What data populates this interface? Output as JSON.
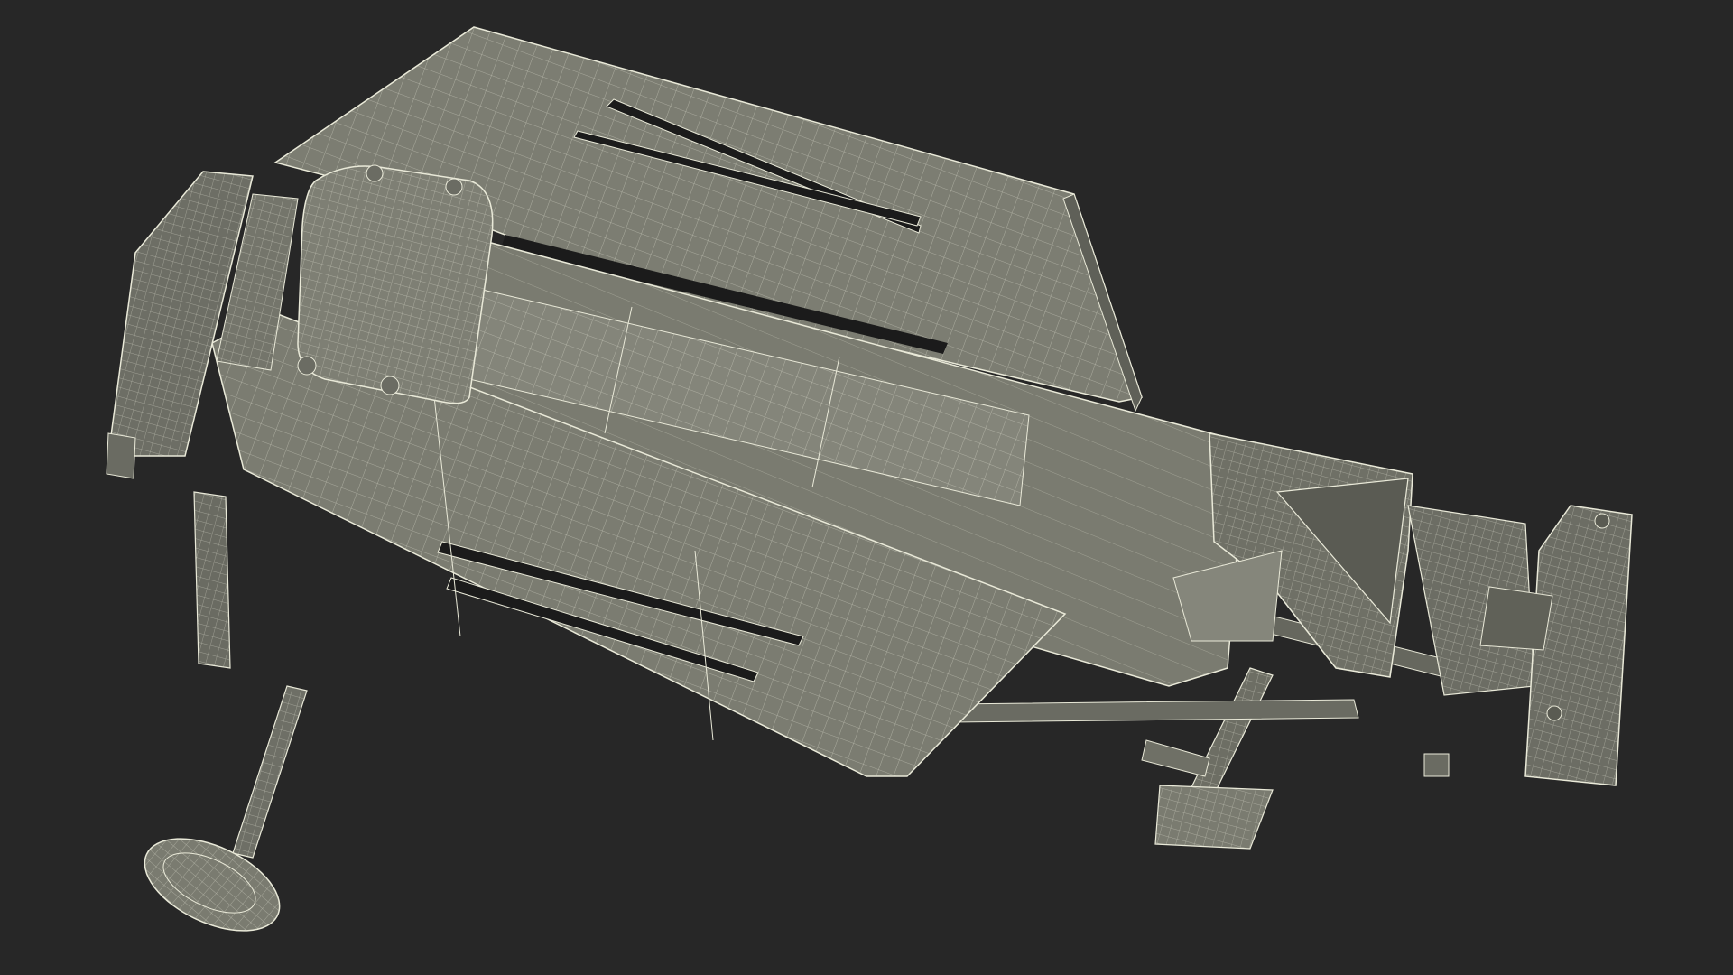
{
  "scene": {
    "background_color": "#272727",
    "surface_color": "#7a7b70",
    "surface_light_color": "#8b8c80",
    "surface_dark_color": "#5d5e55",
    "slot_color": "#1b1b1b",
    "wire_color": "#e9e9d8",
    "subject": "wireframe-log-splitter"
  }
}
